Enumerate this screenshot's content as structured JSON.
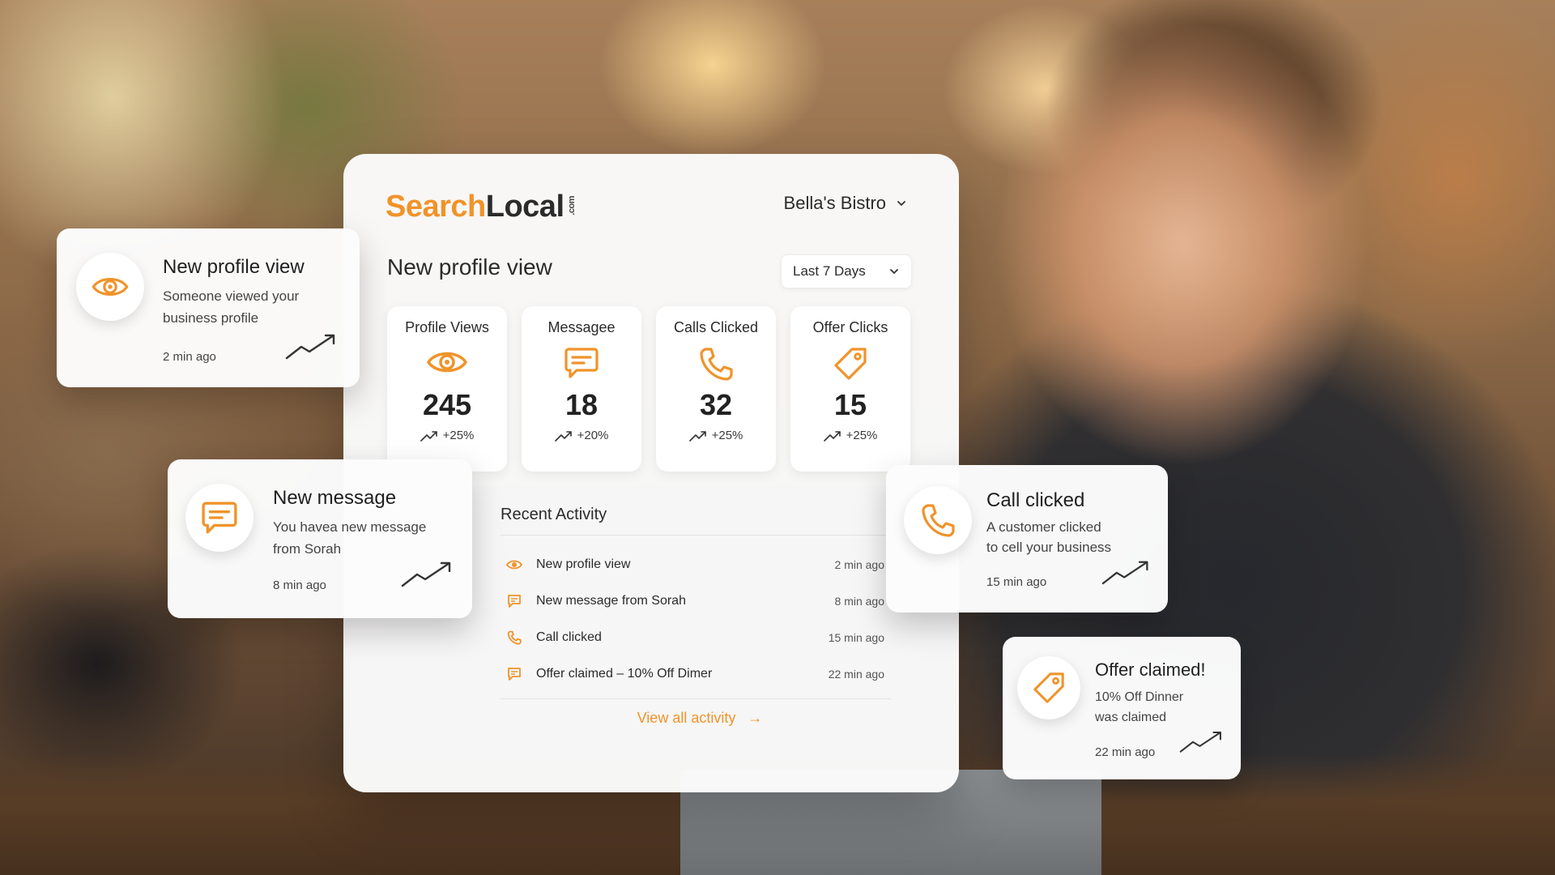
{
  "brand": {
    "name_primary": "Search",
    "name_secondary": "Local",
    "suffix": ".com",
    "accent_color": "#f0932a"
  },
  "business_selector": {
    "label": "Bella's Bistro",
    "icon": "chevron-down-icon"
  },
  "dashboard": {
    "heading": "New profile view",
    "date_range": "Last 7 Days",
    "stats": [
      {
        "label": "Profile Views",
        "icon": "eye-icon",
        "value": "245",
        "delta": "+25%"
      },
      {
        "label": "Messagee",
        "icon": "message-icon",
        "value": "18",
        "delta": "+20%"
      },
      {
        "label": "Calls Clicked",
        "icon": "phone-icon",
        "value": "32",
        "delta": "+25%"
      },
      {
        "label": "Offer Clicks",
        "icon": "tag-icon",
        "value": "15",
        "delta": "+25%"
      }
    ],
    "recent_activity": {
      "title": "Recent Activity",
      "items": [
        {
          "icon": "eye-icon",
          "text": "New profile view",
          "time": "2 min ago"
        },
        {
          "icon": "message-icon",
          "text": "New message from Sorah",
          "time": "8 min ago"
        },
        {
          "icon": "phone-icon",
          "text": "Call clicked",
          "time": "15 min ago"
        },
        {
          "icon": "message-icon",
          "text": "Offer claimed – 10% Off Dimer",
          "time": "22 min ago"
        }
      ],
      "view_all": "View all activity",
      "view_all_arrow": "→"
    }
  },
  "notifications": [
    {
      "title": "New profile view",
      "line1": "Someone viewed your",
      "line2": "business profile",
      "time": "2 min ago",
      "icon": "eye-icon"
    },
    {
      "title": "New message",
      "line1": "You havea new message",
      "line2": "from Sorah",
      "time": "8 min ago",
      "icon": "message-icon"
    },
    {
      "title": "Call clicked",
      "line1": "A customer clicked",
      "line2": "to cell your business",
      "time": "15 min ago",
      "icon": "phone-icon"
    },
    {
      "title": "Offer claimed!",
      "line1": "10% Off Dinner",
      "line2": "was claimed",
      "time": "22 min ago",
      "icon": "tag-icon"
    }
  ]
}
